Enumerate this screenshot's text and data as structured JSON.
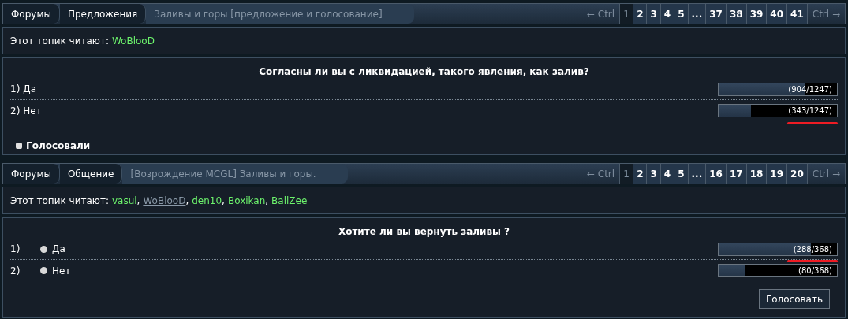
{
  "topics": [
    {
      "breadcrumbs": [
        "Форумы",
        "Предложения"
      ],
      "title": "Заливы и горы [предложение и голосование]",
      "prev": "← Ctrl",
      "next": "Ctrl →",
      "pages": [
        {
          "label": "1",
          "selected": true
        },
        {
          "label": "2",
          "selected": false
        },
        {
          "label": "3",
          "selected": false
        },
        {
          "label": "4",
          "selected": false
        },
        {
          "label": "5",
          "selected": false
        },
        {
          "label": "...",
          "selected": false
        },
        {
          "label": "37",
          "selected": false
        },
        {
          "label": "38",
          "selected": false
        },
        {
          "label": "39",
          "selected": false
        },
        {
          "label": "40",
          "selected": false
        },
        {
          "label": "41",
          "selected": false
        }
      ],
      "readers_label": "Этот топик читают:",
      "readers": [
        {
          "name": "WoBlooD",
          "visited": false
        }
      ],
      "poll": {
        "question": "Согласны ли вы с ликвидацией, такого явления, как залив?",
        "kind": "results",
        "options": [
          {
            "number": "1)",
            "label": "Да",
            "level": 0.725,
            "count": "(904/1247)",
            "underlined": false
          },
          {
            "number": "2)",
            "label": "Нет",
            "level": 0.275,
            "count": "(343/1247)",
            "underlined": true
          }
        ],
        "voters": "Голосовали"
      }
    },
    {
      "breadcrumbs": [
        "Форумы",
        "Общение"
      ],
      "title": "[Возрождение MCGL] Заливы и горы.",
      "prev": "← Ctrl",
      "next": "Ctrl →",
      "pages": [
        {
          "label": "1",
          "selected": true
        },
        {
          "label": "2",
          "selected": false
        },
        {
          "label": "3",
          "selected": false
        },
        {
          "label": "4",
          "selected": false
        },
        {
          "label": "5",
          "selected": false
        },
        {
          "label": "...",
          "selected": false
        },
        {
          "label": "16",
          "selected": false
        },
        {
          "label": "17",
          "selected": false
        },
        {
          "label": "18",
          "selected": false
        },
        {
          "label": "19",
          "selected": false
        },
        {
          "label": "20",
          "selected": false
        }
      ],
      "readers_label": "Этот топик читают:",
      "separator": ",",
      "readers": [
        {
          "name": "vasul",
          "visited": false
        },
        {
          "name": "WoBlooD",
          "visited": true
        },
        {
          "name": "den10",
          "visited": false
        },
        {
          "name": "Boxikan",
          "visited": false
        },
        {
          "name": "BallZee",
          "visited": false
        }
      ],
      "poll": {
        "question": "Хотите ли вы вернуть заливы ?",
        "kind": "vote",
        "options": [
          {
            "number": "1)",
            "label": "Да",
            "level": 0.783,
            "count": "(288/368)",
            "underlined": true,
            "checked": false
          },
          {
            "number": "2)",
            "label": "Нет",
            "level": 0.217,
            "count": "(80/368)",
            "underlined": false,
            "checked": false
          }
        ],
        "button": "Голосовать"
      }
    }
  ]
}
